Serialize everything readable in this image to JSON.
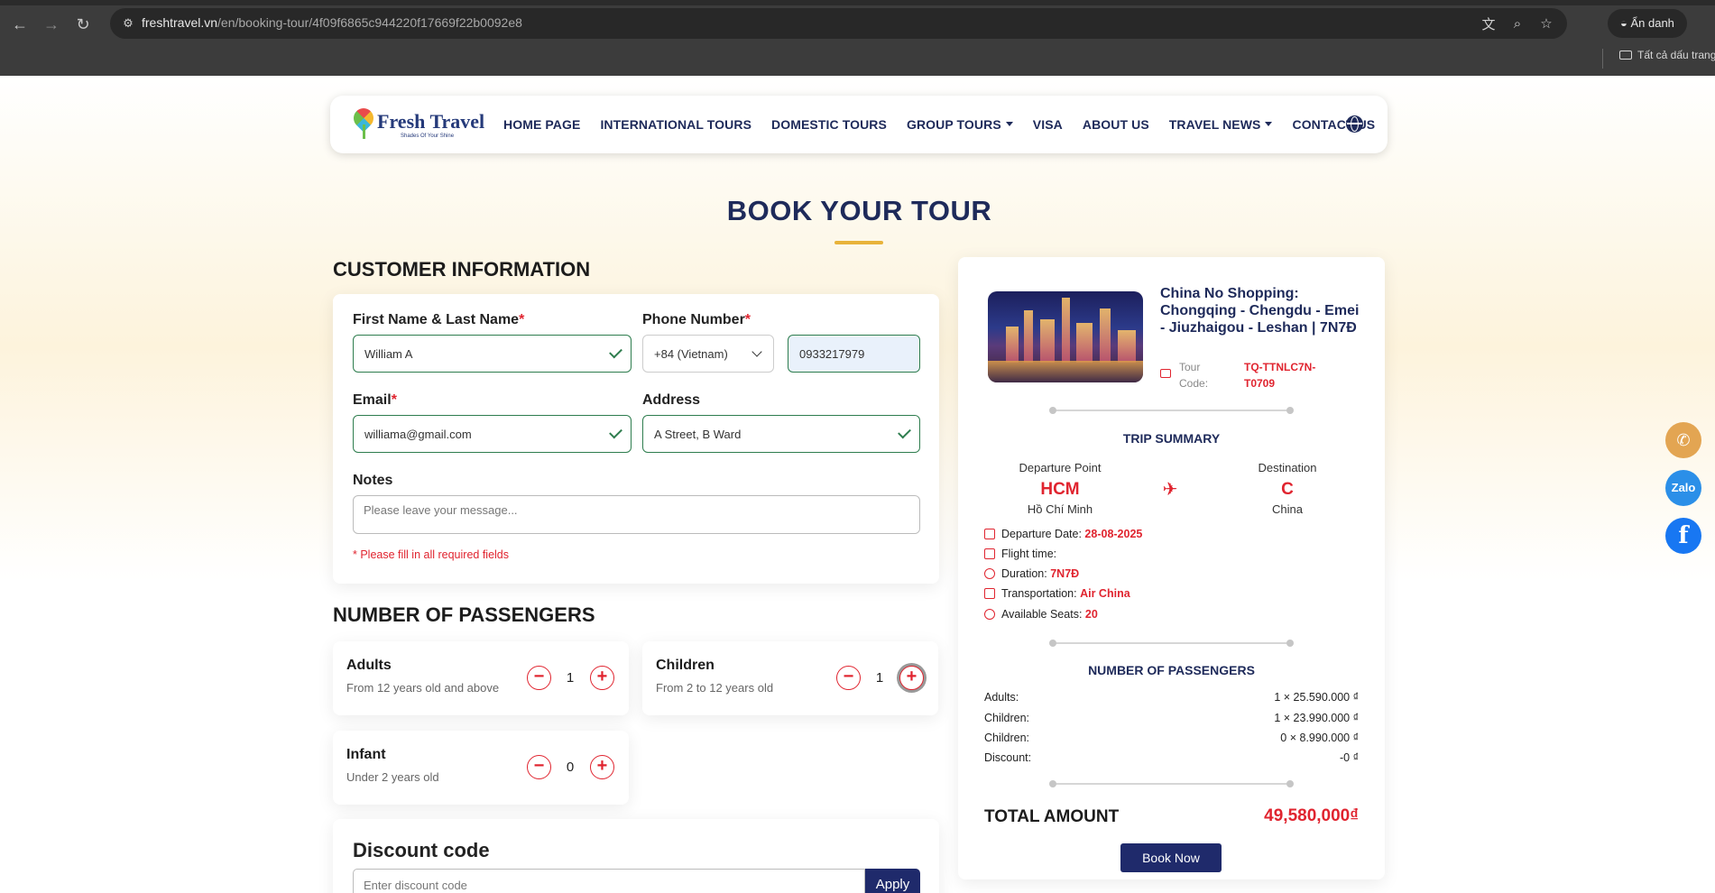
{
  "browser": {
    "url_host": "freshtravel.vn",
    "url_path": "/en/booking-tour/4f09f6865c944220f17669f22b0092e8",
    "incognito_label": "Ẩn danh",
    "bookmarks_label": "Tất cả dấu trang"
  },
  "site": {
    "brand": "Fresh Travel",
    "slogan": "Shades Of Your Shine",
    "menu": [
      "HOME PAGE",
      "INTERNATIONAL TOURS",
      "DOMESTIC TOURS",
      "GROUP TOURS",
      "VISA",
      "ABOUT US",
      "TRAVEL NEWS",
      "CONTACT US"
    ]
  },
  "page_title": "BOOK YOUR TOUR",
  "customer": {
    "heading": "CUSTOMER INFORMATION",
    "name_label": "First Name & Last Name",
    "name_value": "William A",
    "phone_label": "Phone Number",
    "country_code": "+84 (Vietnam)",
    "phone_value": "0933217979",
    "email_label": "Email",
    "email_value": "williama@gmail.com",
    "address_label": "Address",
    "address_value": "A Street, B Ward",
    "notes_label": "Notes",
    "notes_placeholder": "Please leave your message...",
    "required_hint": "* Please fill in all required fields",
    "required_mark": "*"
  },
  "passengers": {
    "heading": "NUMBER OF PASSENGERS",
    "adults": {
      "title": "Adults",
      "sub": "From 12 years old and above",
      "qty": "1"
    },
    "children": {
      "title": "Children",
      "sub": "From 2 to 12 years old",
      "qty": "1"
    },
    "infant": {
      "title": "Infant",
      "sub": "Under 2 years old",
      "qty": "0"
    },
    "minus": "−",
    "plus": "+"
  },
  "discount": {
    "title": "Discount code",
    "placeholder": "Enter discount code",
    "apply": "Apply"
  },
  "summary": {
    "tour_name": "China No Shopping: Chongqing - Chengdu - Emei - Jiuzhaigou - Leshan | 7N7Đ",
    "tour_code_label": "Tour Code:",
    "tour_code": "TQ-TTNLC7N-T0709",
    "trip_heading": "TRIP SUMMARY",
    "departure_label": "Departure Point",
    "departure_code": "HCM",
    "departure_city": "Hồ Chí Minh",
    "destination_label": "Destination",
    "destination_code": "C",
    "destination_city": "China",
    "departure_date_label": "Departure Date:",
    "departure_date": "28-08-2025",
    "flight_time_label": "Flight time:",
    "duration_label": "Duration:",
    "duration": "7N7Đ",
    "transport_label": "Transportation:",
    "transport": "Air China",
    "seats_label": "Available Seats:",
    "seats": "20",
    "pax_heading": "NUMBER OF PASSENGERS",
    "prices": [
      {
        "label": "Adults:",
        "value": "1 × 25.590.000 ₫"
      },
      {
        "label": "Children:",
        "value": "1 × 23.990.000 ₫"
      },
      {
        "label": "Children:",
        "value": "0 × 8.990.000 ₫"
      },
      {
        "label": "Discount:",
        "value": "-0 ₫"
      }
    ],
    "total_label": "TOTAL AMOUNT",
    "total_value": "49,580,000₫",
    "book_label": "Book Now"
  },
  "float": {
    "zalo": "Zalo"
  },
  "colors": {
    "navy": "#1e2a5a",
    "accent_red": "#e0242f",
    "gold": "#e8b33a",
    "button": "#1f2a6b"
  }
}
